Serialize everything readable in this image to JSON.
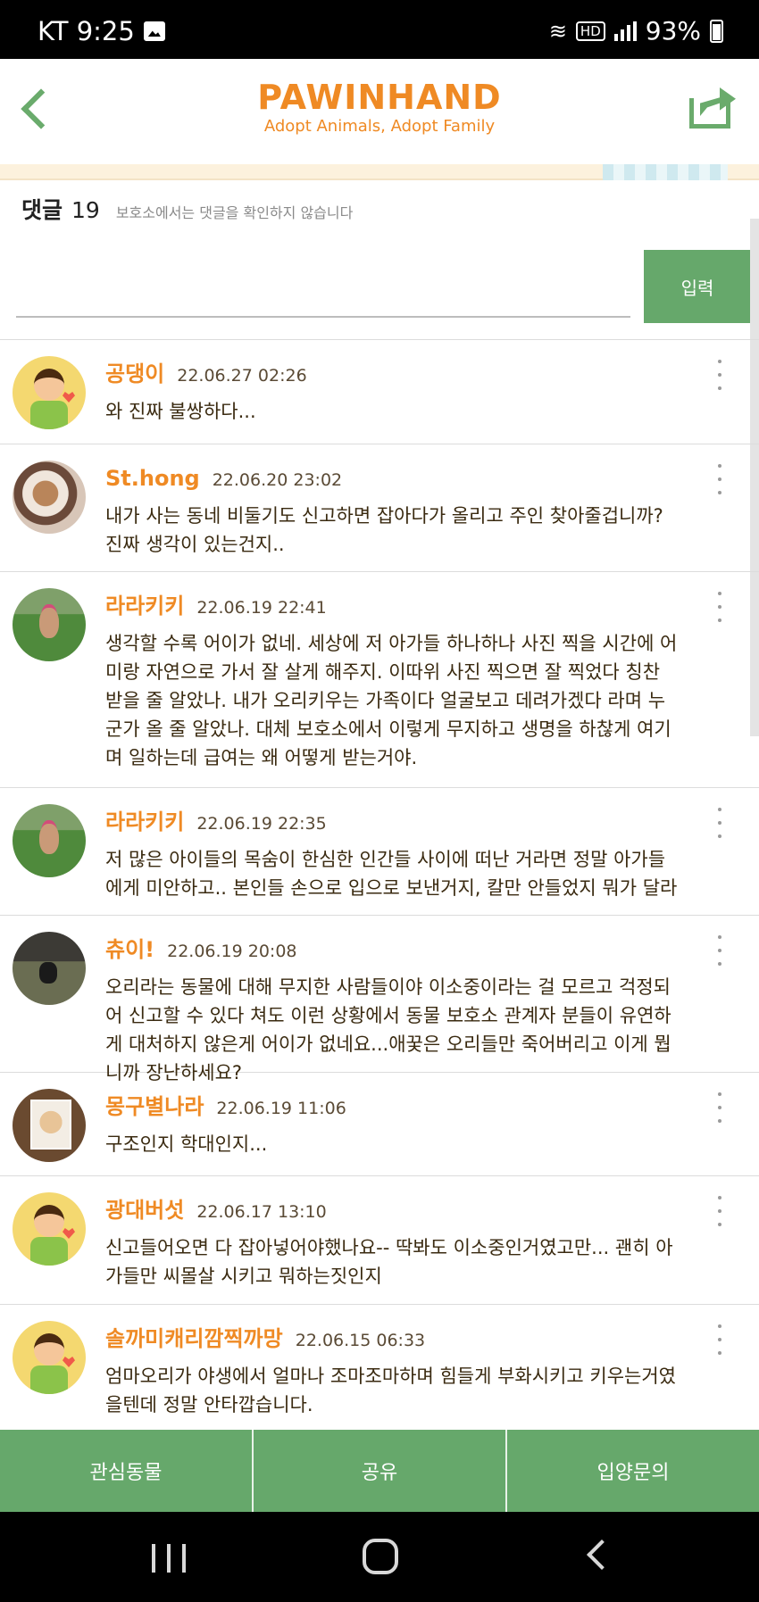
{
  "status_bar": {
    "carrier_time": "KT 9:25",
    "wifi": "wifi-icon",
    "hd": "HD",
    "battery": "93%"
  },
  "header": {
    "title": "PAWINHAND",
    "subtitle": "Adopt Animals, Adopt Family"
  },
  "comments_section": {
    "title": "댓글",
    "count": "19",
    "notice": "보호소에서는 댓글을 확인하지 않습니다",
    "input_value": "",
    "submit_label": "입력"
  },
  "comments": [
    {
      "nickname": "공댕이",
      "time": "22.06.27 02:26",
      "text": "와 진짜 불쌍하다..."
    },
    {
      "nickname": "St.hong",
      "time": "22.06.20 23:02",
      "text": "내가 사는 동네 비둘기도 신고하면 잡아다가 올리고 주인 찾아줄겁니까?진짜 생각이 있는건지.."
    },
    {
      "nickname": "라라키키",
      "time": "22.06.19 22:41",
      "text": "생각할 수록 어이가 없네. 세상에 저 아가들 하나하나 사진 찍을 시간에 어미랑 자연으로 가서 잘 살게 해주지. 이따위 사진 찍으면 잘 찍었다 칭찬 받을 줄 알았나. 내가 오리키우는 가족이다 얼굴보고 데려가겠다 라며 누군가 올 줄 알았나. 대체 보호소에서 이렇게 무지하고 생명을 하찮게 여기며 일하는데 급여는 왜 어떻게 받는거야."
    },
    {
      "nickname": "라라키키",
      "time": "22.06.19 22:35",
      "text": "저 많은 아이들의 목숨이 한심한 인간들 사이에 떠난 거라면 정말 아가들에게 미안하고.. 본인들 손으로 입으로 보낸거지, 칼만 안들었지 뭐가 달라"
    },
    {
      "nickname": "츄이!",
      "time": "22.06.19 20:08",
      "text": "오리라는 동물에 대해 무지한 사람들이야 이소중이라는 걸 모르고 걱정되어 신고할 수 있다 쳐도 이런 상황에서 동물 보호소 관계자 분들이 유연하게 대처하지 않은게 어이가 없네요...애꿎은 오리들만 죽어버리고 이게 뭡니까 장난하세요?"
    },
    {
      "nickname": "몽구별나라",
      "time": "22.06.19 11:06",
      "text": "구조인지 학대인지..."
    },
    {
      "nickname": "광대버섯",
      "time": "22.06.17 13:10",
      "text": "신고들어오면 다 잡아넣어야했나요-- 딱봐도 이소중인거였고만... 괜히 아가들만 씨몰살 시키고 뭐하는짓인지"
    },
    {
      "nickname": "솔까미캐리깜찍까망",
      "time": "22.06.15 06:33",
      "text": "엄마오리가 야생에서 얼마나 조마조마하며 힘들게 부화시키고 키우는거였을텐데 정말 안타깝습니다."
    }
  ],
  "bottom_bar": {
    "favorites": "관심동물",
    "share": "공유",
    "adopt": "입양문의"
  }
}
